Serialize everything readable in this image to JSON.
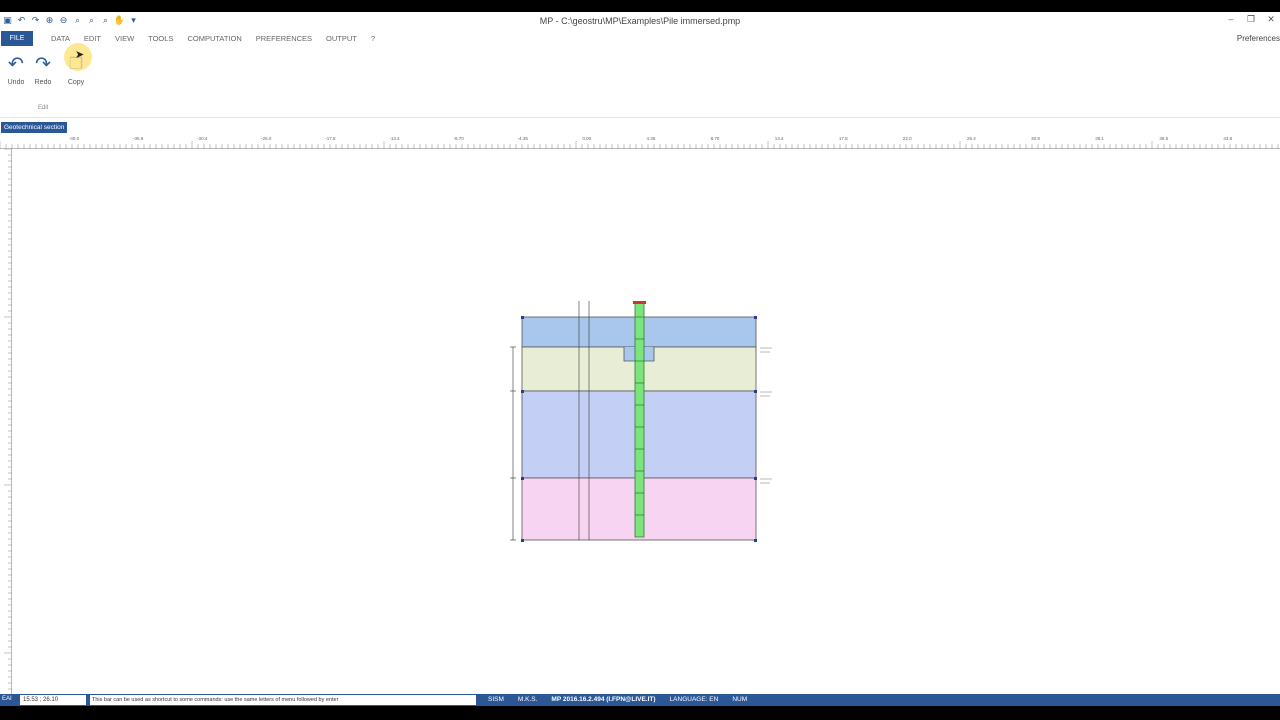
{
  "window": {
    "title": "MP - C:\\geostru\\MP\\Examples\\Pile immersed.pmp",
    "controls": [
      "–",
      "❐",
      "✕"
    ]
  },
  "quick_access": [
    "save-icon",
    "undo-icon",
    "redo-icon",
    "zoom-in-icon",
    "zoom-out-icon",
    "zoom-window-icon",
    "zoom-all-icon",
    "pan-icon"
  ],
  "menu": {
    "file_label": "FILE",
    "tabs": [
      "DATA",
      "EDIT",
      "VIEW",
      "TOOLS",
      "COMPUTATION",
      "PREFERENCES",
      "OUTPUT",
      "?"
    ],
    "preferences_link": "Preferences"
  },
  "ribbon": {
    "undo_label": "Undo",
    "redo_label": "Redo",
    "copy_label": "Copy",
    "group_label": "Edit"
  },
  "section_tab": "Geotechnical section",
  "ruler": {
    "top_ticks": [
      "-40.0",
      "-35.6",
      "-30.4",
      "-26.0",
      "-17.8",
      "-13.4",
      "-8.70",
      "-4.35",
      "0.00",
      "4.35",
      "8.70",
      "13.4",
      "17.8",
      "22.0",
      "26.4",
      "30.8",
      "35.1",
      "39.5",
      "43.8",
      "48.2"
    ]
  },
  "drawing": {
    "layers": [
      {
        "name": "layer-1",
        "color": "#a9c6ec"
      },
      {
        "name": "layer-2",
        "color": "#e8eed6"
      },
      {
        "name": "layer-3",
        "color": "#c4cff5"
      },
      {
        "name": "layer-4",
        "color": "#f7d4f2"
      }
    ],
    "pile_color": "#7de37d",
    "pile_head_color": "#cc3333"
  },
  "status": {
    "prefix": "EAI",
    "coords": "15.53 ; 26.10",
    "hint": "This bar can be used as shortcut to some commands: use the same letters of menu followed by enter",
    "items": [
      "SISM",
      "M.K.S.",
      "MP 2016.16.2.494 (I.FPN@LIVE.IT)",
      "LANGUAGE: EN",
      "NUM"
    ]
  }
}
